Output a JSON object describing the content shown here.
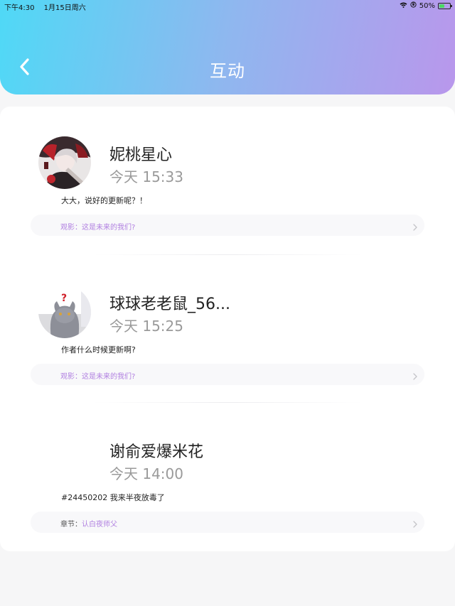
{
  "status_bar": {
    "time": "下午4:30",
    "date": "1月15日周六",
    "battery_percent": "50%",
    "battery_level": 0.5
  },
  "nav": {
    "title": "互动",
    "back_icon": "chevron-left-icon"
  },
  "colors": {
    "header_start": "#4fd9f6",
    "header_end": "#b997ec",
    "accent_purple": "#b07fe0"
  },
  "comments": [
    {
      "user_name": "妮桃星心",
      "time": "今天 15:33",
      "content": "大大，说好的更新呢？！",
      "ref_label": "观影：",
      "ref_title": "这是未来的我们?"
    },
    {
      "user_name": "球球老老鼠_56...",
      "time": "今天 15:25",
      "content": "作者什么时候更新啊?",
      "ref_label": "观影：",
      "ref_title": "这是未来的我们?"
    },
    {
      "user_name": "谢俞爱爆米花",
      "time": "今天 14:00",
      "content": "#24450202 我来半夜放毒了",
      "ref_label": "章节：",
      "ref_title": "认白夜师父"
    }
  ]
}
